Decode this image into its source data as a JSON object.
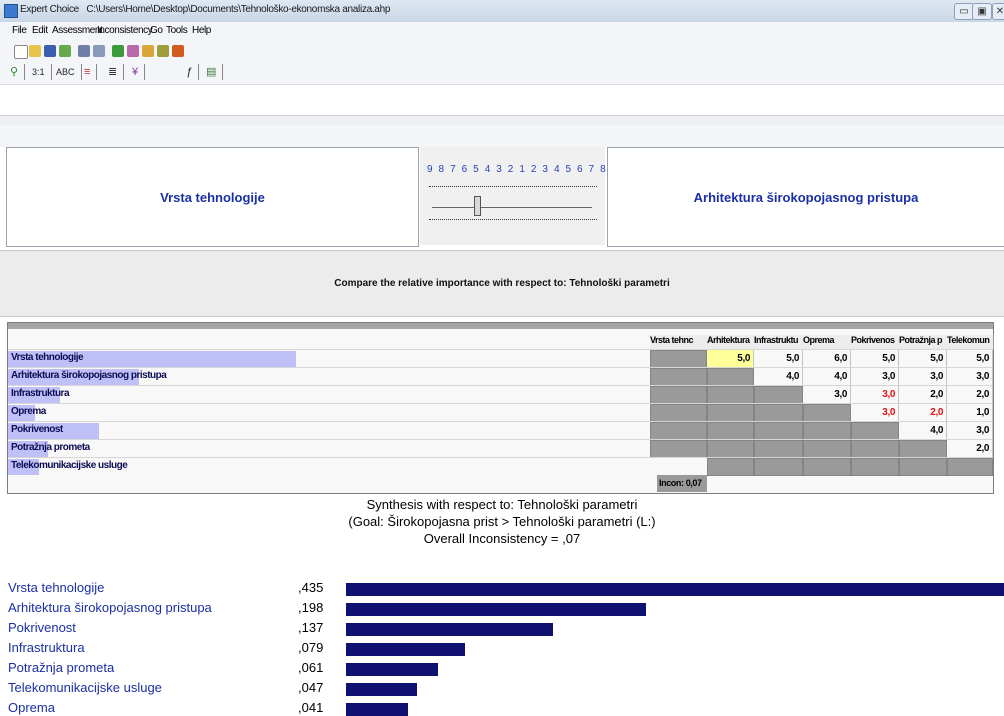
{
  "window": {
    "app_name": "Expert Choice",
    "file_path": "C:\\Users\\Home\\Desktop\\Documents\\Tehnološko-ekonomska analiza.ahp"
  },
  "menu": [
    "File",
    "Edit",
    "Assessment",
    "Inconsistency",
    "Go",
    "Tools",
    "Help"
  ],
  "tabs": [
    "3:1",
    "ABC"
  ],
  "comparison": {
    "left_label": "Vrsta tehnologije",
    "right_label": "Arhitektura širokopojasnog pristupa",
    "scale": "9 8 7 6 5 4 3 2 1 2 3 4 5 6 7 8 9",
    "compare_text": "Compare the relative importance with respect to: Tehnološki parametri"
  },
  "matrix": {
    "columns": [
      "Vrsta tehnc",
      "Arhitektura",
      "Infrastruktu",
      "Oprema",
      "Pokrivenos",
      "Potražnja p",
      "Telekomun"
    ],
    "rows": [
      {
        "label": "Vrsta tehnologije",
        "bar": 0.435,
        "cells": [
          "",
          "5,0",
          "5,0",
          "6,0",
          "5,0",
          "5,0",
          "5,0"
        ]
      },
      {
        "label": "Arhitektura širokopojasnog pristupa",
        "bar": 0.198,
        "cells": [
          "",
          "",
          "4,0",
          "4,0",
          "3,0",
          "3,0",
          "3,0"
        ]
      },
      {
        "label": "Infrastruktura",
        "bar": 0.079,
        "cells": [
          "",
          "",
          "",
          "3,0",
          "3,0",
          "2,0",
          "2,0"
        ]
      },
      {
        "label": "Oprema",
        "bar": 0.041,
        "cells": [
          "",
          "",
          "",
          "",
          "3,0",
          "2,0",
          "1,0"
        ]
      },
      {
        "label": "Pokrivenost",
        "bar": 0.137,
        "cells": [
          "",
          "",
          "",
          "",
          "",
          "4,0",
          "3,0"
        ]
      },
      {
        "label": "Potražnja prometa",
        "bar": 0.061,
        "cells": [
          "",
          "",
          "",
          "",
          "",
          "",
          "2,0"
        ]
      },
      {
        "label": "Telekomunikacijske usluge",
        "bar": 0.047,
        "cells": [
          "",
          "",
          "",
          "",
          "",
          "",
          ""
        ]
      }
    ],
    "inconsistency": "Incon: 0,07"
  },
  "synthesis": {
    "line1": "Synthesis with respect to: Tehnološki parametri",
    "line2": "(Goal: Širokopojasna prist > Tehnološki parametri (L:)",
    "line3": "Overall Inconsistency = ,07",
    "results": [
      {
        "label": "Vrsta tehnologije",
        "value_text": ",435",
        "value": 0.435
      },
      {
        "label": "Arhitektura širokopojasnog pristupa",
        "value_text": ",198",
        "value": 0.198
      },
      {
        "label": "Pokrivenost",
        "value_text": ",137",
        "value": 0.137
      },
      {
        "label": "Infrastruktura",
        "value_text": ",079",
        "value": 0.079
      },
      {
        "label": "Potražnja prometa",
        "value_text": ",061",
        "value": 0.061
      },
      {
        "label": "Telekomunikacijske usluge",
        "value_text": ",047",
        "value": 0.047
      },
      {
        "label": "Oprema",
        "value_text": ",041",
        "value": 0.041
      }
    ]
  },
  "colors": {
    "title_blue": "#1a2fa8",
    "bar_navy": "#101070",
    "highlight_yellow": "#ffff99",
    "inconsistent_red": "#e01010",
    "priority_bar": "#c0c0f8"
  }
}
